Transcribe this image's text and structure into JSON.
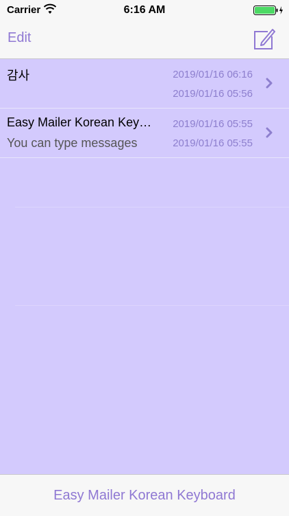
{
  "status_bar": {
    "carrier": "Carrier",
    "time": "6:16 AM",
    "icons": [
      "wifi-icon",
      "battery-icon",
      "charging-bolt-icon"
    ],
    "battery_color": "#4cd964"
  },
  "nav_bar": {
    "edit_label": "Edit",
    "compose_icon": "compose-icon"
  },
  "list": {
    "items": [
      {
        "title": "감사",
        "subtitle": "",
        "modified": "2019/01/16 06:16",
        "created": "2019/01/16 05:56"
      },
      {
        "title": "Easy Mailer Korean Keyboard",
        "subtitle": "You can type messages",
        "modified": "2019/01/16 05:55",
        "created": "2019/01/16 05:55"
      }
    ]
  },
  "tab_bar": {
    "label": "Easy Mailer Korean Keyboard"
  },
  "colors": {
    "accent": "#8f78d3",
    "list_background": "#d3cafd",
    "date_text": "#8d7fce",
    "bar_background": "#f7f7f7"
  }
}
